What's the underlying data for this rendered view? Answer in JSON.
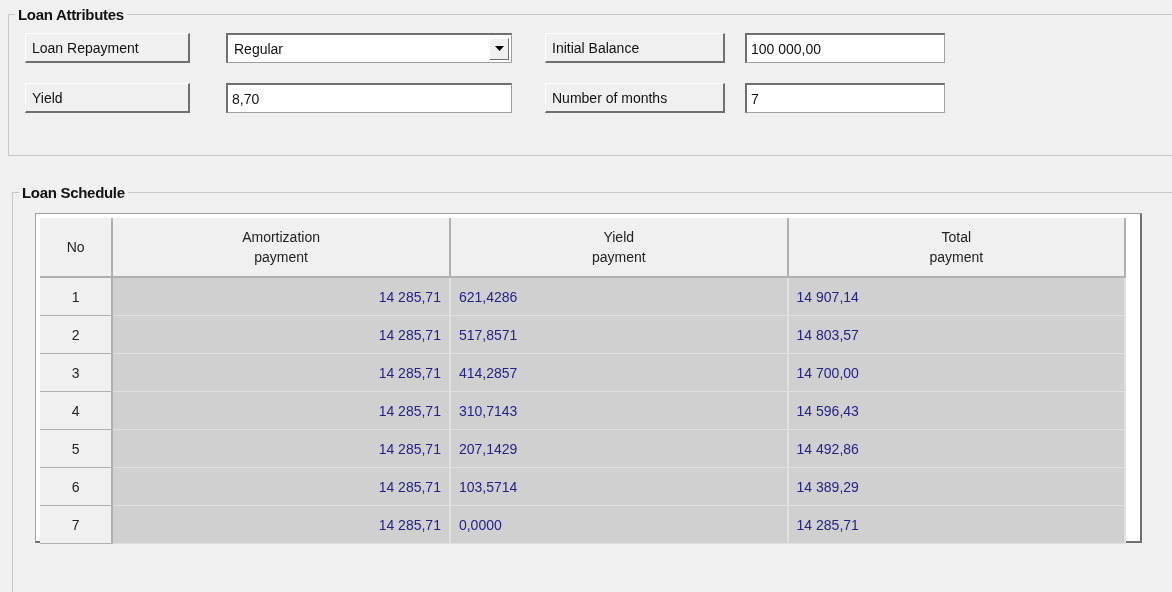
{
  "loan_attributes": {
    "title": "Loan Attributes",
    "fields": [
      {
        "kind": "dropdown",
        "label": "Loan Repayment",
        "value": "Regular"
      },
      {
        "kind": "text",
        "label": "Initial Balance",
        "value": "100 000,00"
      },
      {
        "kind": "text",
        "label": "Yield",
        "value": "8,70"
      },
      {
        "kind": "text",
        "label": "Number of months",
        "value": "7"
      }
    ]
  },
  "loan_schedule": {
    "title": "Loan Schedule",
    "table": {
      "columns": [
        "No",
        "Amortization\npayment",
        "Yield\npayment",
        "Total\npayment"
      ],
      "rows": [
        [
          "1",
          "14 285,71",
          "621,4286",
          "14 907,14"
        ],
        [
          "2",
          "14 285,71",
          "517,8571",
          "14 803,57"
        ],
        [
          "3",
          "14 285,71",
          "414,2857",
          "14 700,00"
        ],
        [
          "4",
          "14 285,71",
          "310,7143",
          "14 596,43"
        ],
        [
          "5",
          "14 285,71",
          "207,1429",
          "14 492,86"
        ],
        [
          "6",
          "14 285,71",
          "103,5714",
          "14 389,29"
        ],
        [
          "7",
          "14 285,71",
          "0,0000",
          "14 285,71"
        ]
      ]
    }
  }
}
